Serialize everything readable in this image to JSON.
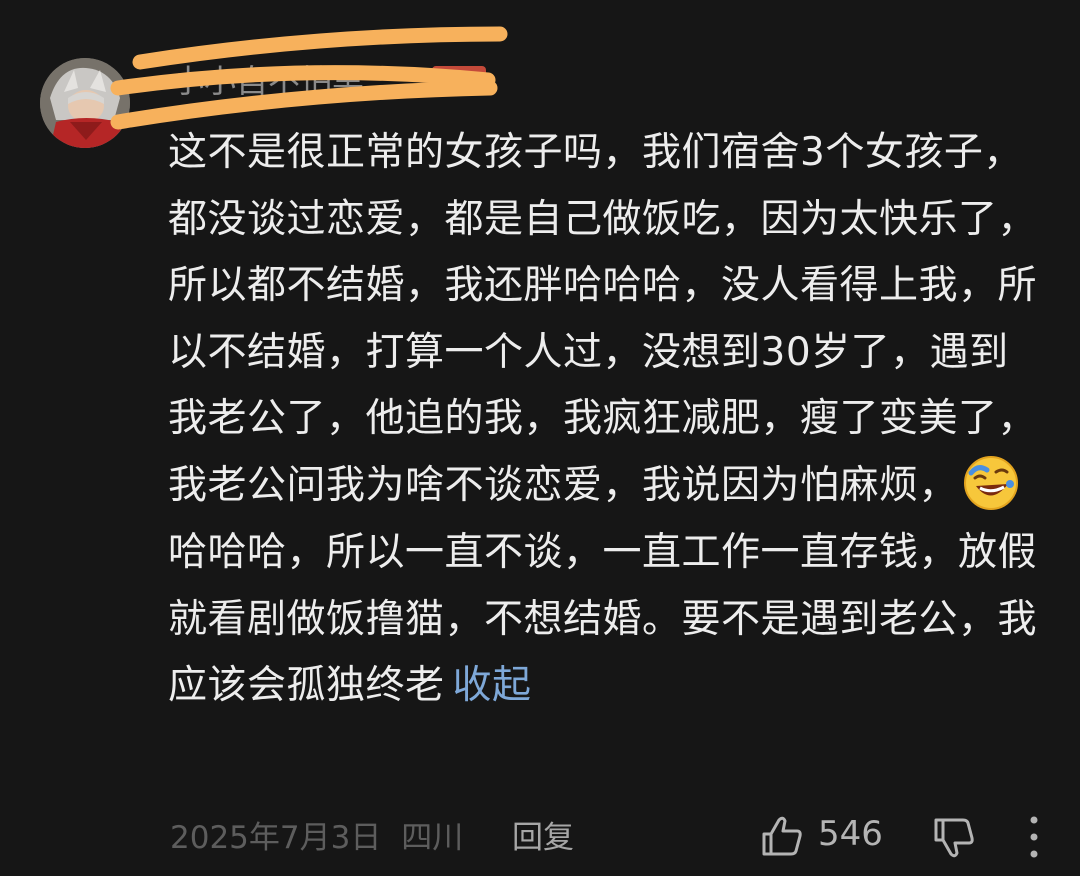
{
  "comment": {
    "username": "小小自不怕黑",
    "text_before_emoji": "这不是很正常的女孩子吗，我们宿舍3个女孩子，都没谈过恋爱，都是自己做饭吃，因为太快乐了，所以都不结婚，我还胖哈哈哈，没人看得上我，所以不结婚，打算一个人过，没想到30岁了，遇到我老公了，他追的我，我疯狂减肥，瘦了变美了，我老公问我为啥不谈恋爱，我说因为怕麻烦，",
    "emoji": "laughing-crying-emoji",
    "text_after_emoji": "哈哈哈，所以一直不谈，一直工作一直存钱，放假就看剧做饭撸猫，不想结婚。要不是遇到老公，我应该会孤独终老",
    "collapse_label": "收起",
    "date": "2025年7月3日",
    "location": "四川",
    "reply_label": "回复",
    "like_count": "546"
  },
  "colors": {
    "background": "#161616",
    "body_text": "#ededed",
    "link": "#7ea8d8",
    "meta_text": "#5d5d5d",
    "redaction": "#f7b15c"
  }
}
